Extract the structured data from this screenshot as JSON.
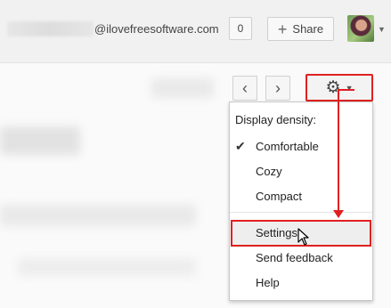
{
  "header": {
    "email_domain": "@ilovefreesoftware.com",
    "count": "0",
    "share_label": "Share"
  },
  "menu": {
    "heading": "Display density:",
    "items": [
      "Comfortable",
      "Cozy",
      "Compact",
      "Settings",
      "Send feedback",
      "Help"
    ],
    "selected": "Comfortable",
    "highlighted": "Settings"
  },
  "colors": {
    "highlight_border": "#e02020",
    "menu_background": "#ffffff",
    "topbar_background": "#f1f1f1"
  },
  "icons": [
    "plus-icon",
    "avatar",
    "chevron-left-icon",
    "chevron-right-icon",
    "gear-icon",
    "caret-down-icon",
    "checkmark-icon",
    "cursor-icon"
  ]
}
